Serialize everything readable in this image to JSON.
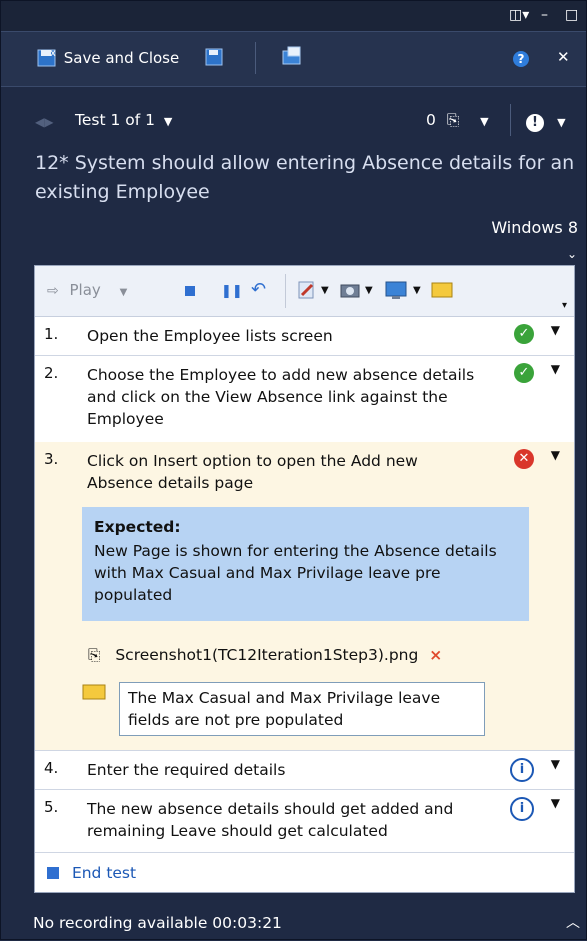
{
  "window": {
    "controls": {
      "layout": "◫▾",
      "minimize": "–",
      "maximize": "□"
    }
  },
  "toolbar": {
    "save_close_label": "Save and Close",
    "help": "?",
    "close": "✕"
  },
  "test_nav": {
    "label": "Test 1 of 1",
    "attachments_count": "0"
  },
  "title": "12* System should allow entering Absence details for an existing Employee",
  "environment": "Windows 8",
  "player_toolbar": {
    "play_label": "Play"
  },
  "steps": [
    {
      "num": "1.",
      "text": "Open the Employee lists screen",
      "status": "passed"
    },
    {
      "num": "2.",
      "text": "Choose the Employee to add new absence details and click on the View Absence link against the Employee",
      "status": "passed"
    },
    {
      "num": "3.",
      "text": "Click on Insert option to open the Add new Absence details page",
      "status": "failed",
      "expected_label": "Expected:",
      "expected_text": "New Page is shown for entering the Absence details with Max Casual and Max Privilage leave pre populated",
      "attachment": "Screenshot1(TC12Iteration1Step3).png",
      "comment": "The Max Casual and Max Privilage leave fields are not pre populated"
    },
    {
      "num": "4.",
      "text": "Enter the required details",
      "status": "not-run"
    },
    {
      "num": "5.",
      "text": "The new absence details should get added and remaining Leave should get calculated",
      "status": "not-run"
    }
  ],
  "end_test_label": "End test",
  "status_bar": {
    "recording_text": "No recording available 00:03:21"
  },
  "colors": {
    "background": "#1f2a44",
    "expected_bg": "#b7d3f3",
    "failed_step_bg": "#fdf6e3",
    "pass": "#3aa33a",
    "fail": "#d9362b",
    "link": "#1c58b5"
  }
}
